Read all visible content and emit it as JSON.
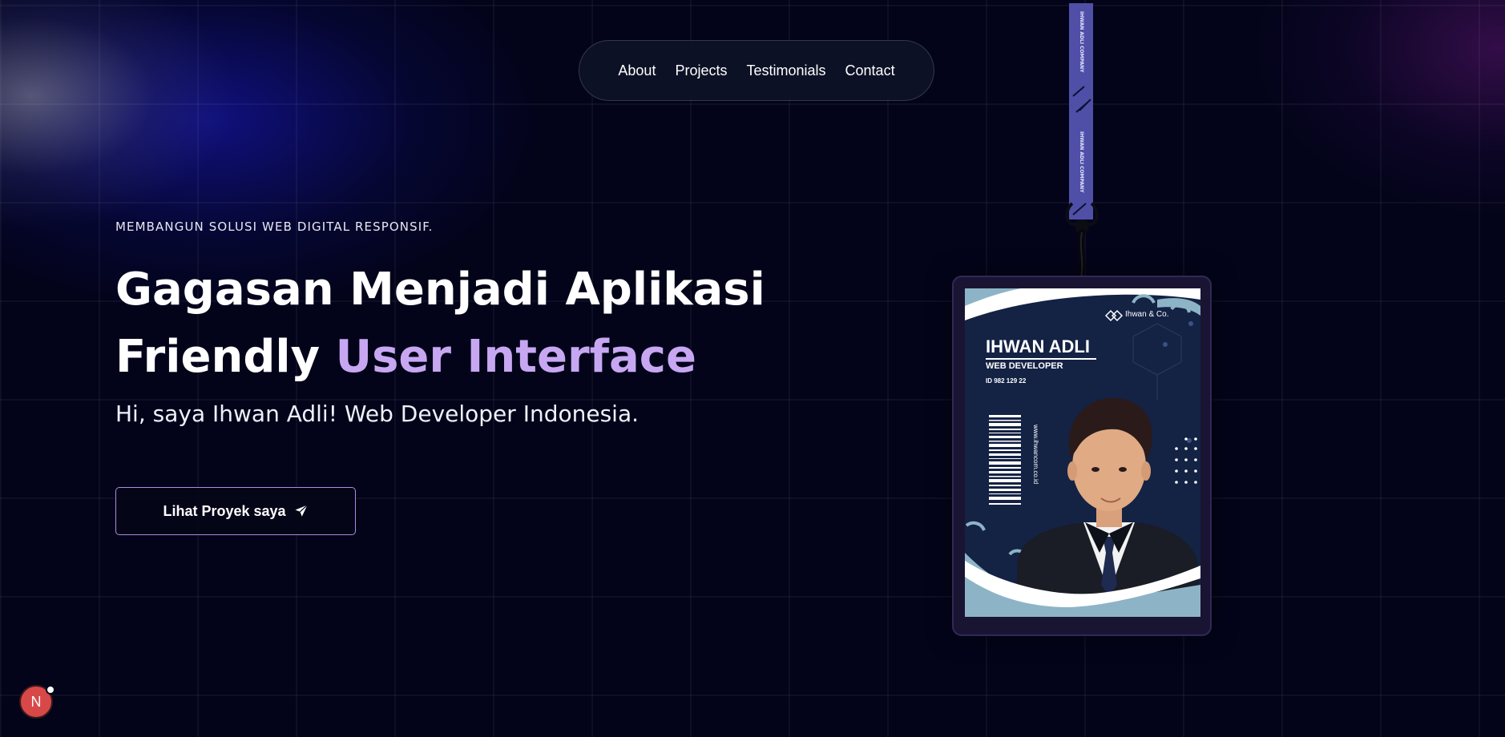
{
  "nav": {
    "items": [
      {
        "label": "About"
      },
      {
        "label": "Projects"
      },
      {
        "label": "Testimonials"
      },
      {
        "label": "Contact"
      }
    ]
  },
  "hero": {
    "eyebrow": "MEMBANGUN SOLUSI WEB DIGITAL RESPONSIF.",
    "headline_line1": "Gagasan Menjadi Aplikasi",
    "headline_line2_plain": "Friendly",
    "headline_line2_accent": "User Interface",
    "subtitle": "Hi, saya Ihwan Adli! Web Developer Indonesia.",
    "cta_label": "Lihat Proyek saya",
    "cta_icon": "paper-plane-icon",
    "accent_color": "#c7a7f2"
  },
  "lanyard": {
    "strap_text": "IHWAN ADLI COMPANY",
    "strap_color": "#4f4fa8"
  },
  "id_card": {
    "company": "Ihwan & Co.",
    "name": "IHWAN ADLI",
    "role": "WEB DEVELOPER",
    "id_number": "ID 982 129 22",
    "website": "www.ihwancom.co.id"
  },
  "dev_badge": {
    "letter": "N"
  }
}
